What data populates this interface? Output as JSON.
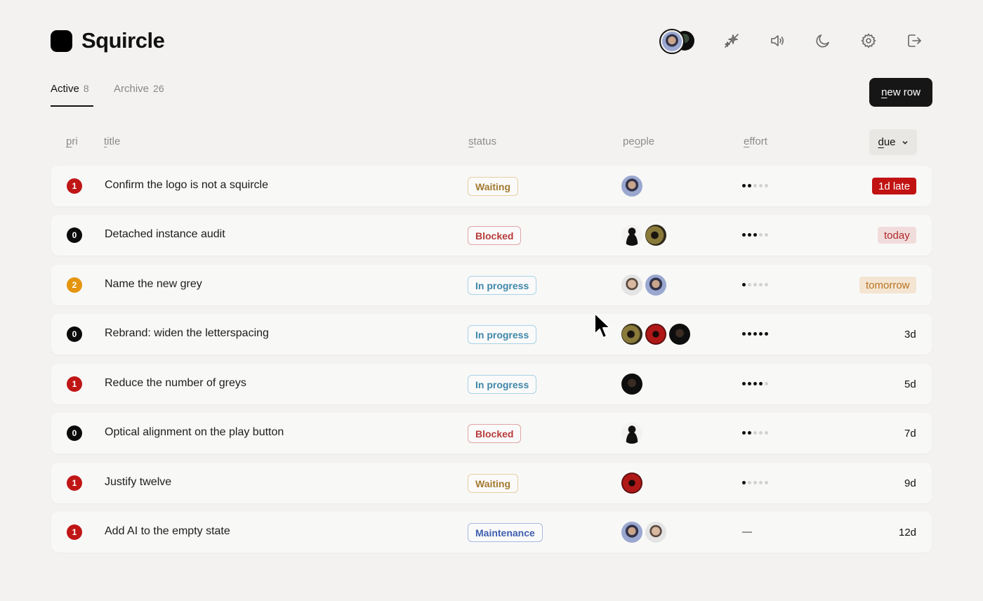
{
  "app": {
    "title": "Squircle"
  },
  "header": {
    "icons": [
      "avatar-stack",
      "sparkle-off-icon",
      "speaker-icon",
      "moon-icon",
      "gear-icon",
      "logout-icon"
    ]
  },
  "tabs": [
    {
      "label": "Active",
      "count": "8",
      "active": true
    },
    {
      "label": "Archive",
      "count": "26",
      "active": false
    }
  ],
  "toolbar": {
    "new_row_first": "n",
    "new_row_rest": "ew row"
  },
  "columns": {
    "pri": {
      "u": "p",
      "rest": "ri"
    },
    "title": {
      "u": "t",
      "rest": "itle"
    },
    "status": {
      "u": "s",
      "rest": "tatus"
    },
    "people": {
      "pre": "pe",
      "u": "o",
      "rest": "ple"
    },
    "effort": {
      "u": "e",
      "rest": "ffort"
    },
    "due": {
      "u": "d",
      "rest": "ue"
    }
  },
  "colors": {
    "pri_1": "#c01616",
    "pri_0": "#0b0b0b",
    "pri_2": "#e5950d",
    "waiting": "#a37a2e",
    "blocked": "#b83b3b",
    "in_progress": "#3e87a8",
    "maintenance": "#3f5fae"
  },
  "rows": [
    {
      "pri": "1",
      "title": "Confirm the logo is not a squircle",
      "status": "Waiting",
      "people": [
        "p1"
      ],
      "effort": 2,
      "due": "1d late",
      "due_style": "late"
    },
    {
      "pri": "0",
      "title": "Detached instance audit",
      "status": "Blocked",
      "people": [
        "p5",
        "p3"
      ],
      "effort": 3,
      "due": "today",
      "due_style": "today"
    },
    {
      "pri": "2",
      "title": "Name the new grey",
      "status": "In progress",
      "people": [
        "p2",
        "p1"
      ],
      "effort": 1,
      "due": "tomorrow",
      "due_style": "tomorrow"
    },
    {
      "pri": "0",
      "title": "Rebrand: widen the letterspacing",
      "status": "In progress",
      "people": [
        "p3",
        "p4",
        "p6"
      ],
      "effort": 5,
      "due": "3d",
      "due_style": "plain"
    },
    {
      "pri": "1",
      "title": "Reduce the number of greys",
      "status": "In progress",
      "people": [
        "p6"
      ],
      "effort": 4,
      "due": "5d",
      "due_style": "plain"
    },
    {
      "pri": "0",
      "title": "Optical alignment on the play button",
      "status": "Blocked",
      "people": [
        "p5"
      ],
      "effort": 2,
      "due": "7d",
      "due_style": "plain"
    },
    {
      "pri": "1",
      "title": "Justify twelve",
      "status": "Waiting",
      "people": [
        "p4"
      ],
      "effort": 1,
      "due": "9d",
      "due_style": "plain"
    },
    {
      "pri": "1",
      "title": "Add AI to the empty state",
      "status": "Maintenance",
      "people": [
        "p1",
        "p2"
      ],
      "effort": 0,
      "due": "12d",
      "due_style": "plain"
    }
  ]
}
